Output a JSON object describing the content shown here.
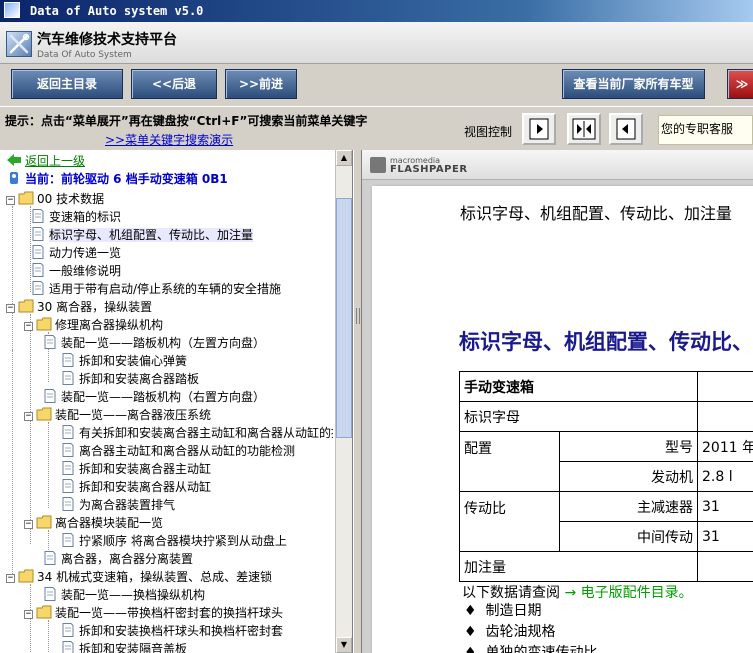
{
  "window": {
    "title": "Data of Auto system v5.0"
  },
  "banner": {
    "title_cn": "汽车维修技术支持平台",
    "title_en": "Data Of Auto System"
  },
  "toolbar": {
    "home_label": "返回主目录",
    "back_label": "<<后退",
    "forward_label": ">>前进",
    "all_models_label": "查看当前厂家所有车型",
    "more_label": "≫"
  },
  "hint": {
    "text": "提示：点击“菜单展开”再在键盘按“Ctrl+F”可搜索当前菜单关键字",
    "link": ">>菜单关键字搜索演示",
    "view_control": "视图控制",
    "service": "您的专职客服"
  },
  "tree": {
    "back": "返回上一级",
    "current": "当前：前轮驱动 6 档手动变速箱 0B1",
    "items": [
      "00 技术数据",
      "变速箱的标识",
      "标识字母、机组配置、传动比、加注量",
      "动力传递一览",
      "一般维修说明",
      "适用于带有启动/停止系统的车辆的安全措施",
      "30 离合器，操纵装置",
      "修理离合器操纵机构",
      "装配一览——踏板机构（左置方向盘）",
      "拆卸和安装偏心弹簧",
      "拆卸和安装离合器踏板",
      "装配一览——踏板机构（右置方向盘）",
      "装配一览——离合器液压系统",
      "有关拆卸和安装离合器主动缸和离合器从动缸的提示",
      "离合器主动缸和离合器从动缸的功能检测",
      "拆卸和安装离合器主动缸",
      "拆卸和安装离合器从动缸",
      "为离合器装置排气",
      "离合器模块装配一览",
      "拧紧顺序 将离合器模块拧紧到从动盘上",
      "离合器，离合器分离装置",
      "34 机械式变速箱，操纵装置、总成、差速锁",
      "装配一览——换档操纵机构",
      "装配一览——带换档杆密封套的换挡杆球头",
      "拆卸和安装换档杆球头和换档杆密封套",
      "拆卸和安装隔音盖板"
    ]
  },
  "viewer": {
    "brand_small": "macromedia",
    "brand": "FLASHPAPER",
    "doc_title": "标识字母、机组配置、传动比、加注量",
    "doc_heading": "标识字母、机组配置、传动比、加注量",
    "table": {
      "header": "手动变速箱",
      "row_id": "标识字母",
      "row_config": "配置",
      "model_label": "型号",
      "model_value": "2011 年",
      "engine_label": "发动机",
      "engine_value": "2.8 l",
      "row_ratio": "传动比",
      "final_drive_label": "主减速器",
      "final_drive_value": "31",
      "intermediate_label": "中间传动",
      "intermediate_value": "31",
      "row_fill": "加注量"
    },
    "note_text": "以下数据请查阅",
    "note_link": "→ 电子版配件目录。",
    "bullets": [
      "制造日期",
      "齿轮油规格",
      "单独的变速传动比"
    ],
    "bullet_mark": "♦"
  },
  "colors": {
    "accent": "#2c4d7c",
    "link": "#0000cc",
    "back_link": "#008000",
    "heading": "#1a1a8c"
  }
}
